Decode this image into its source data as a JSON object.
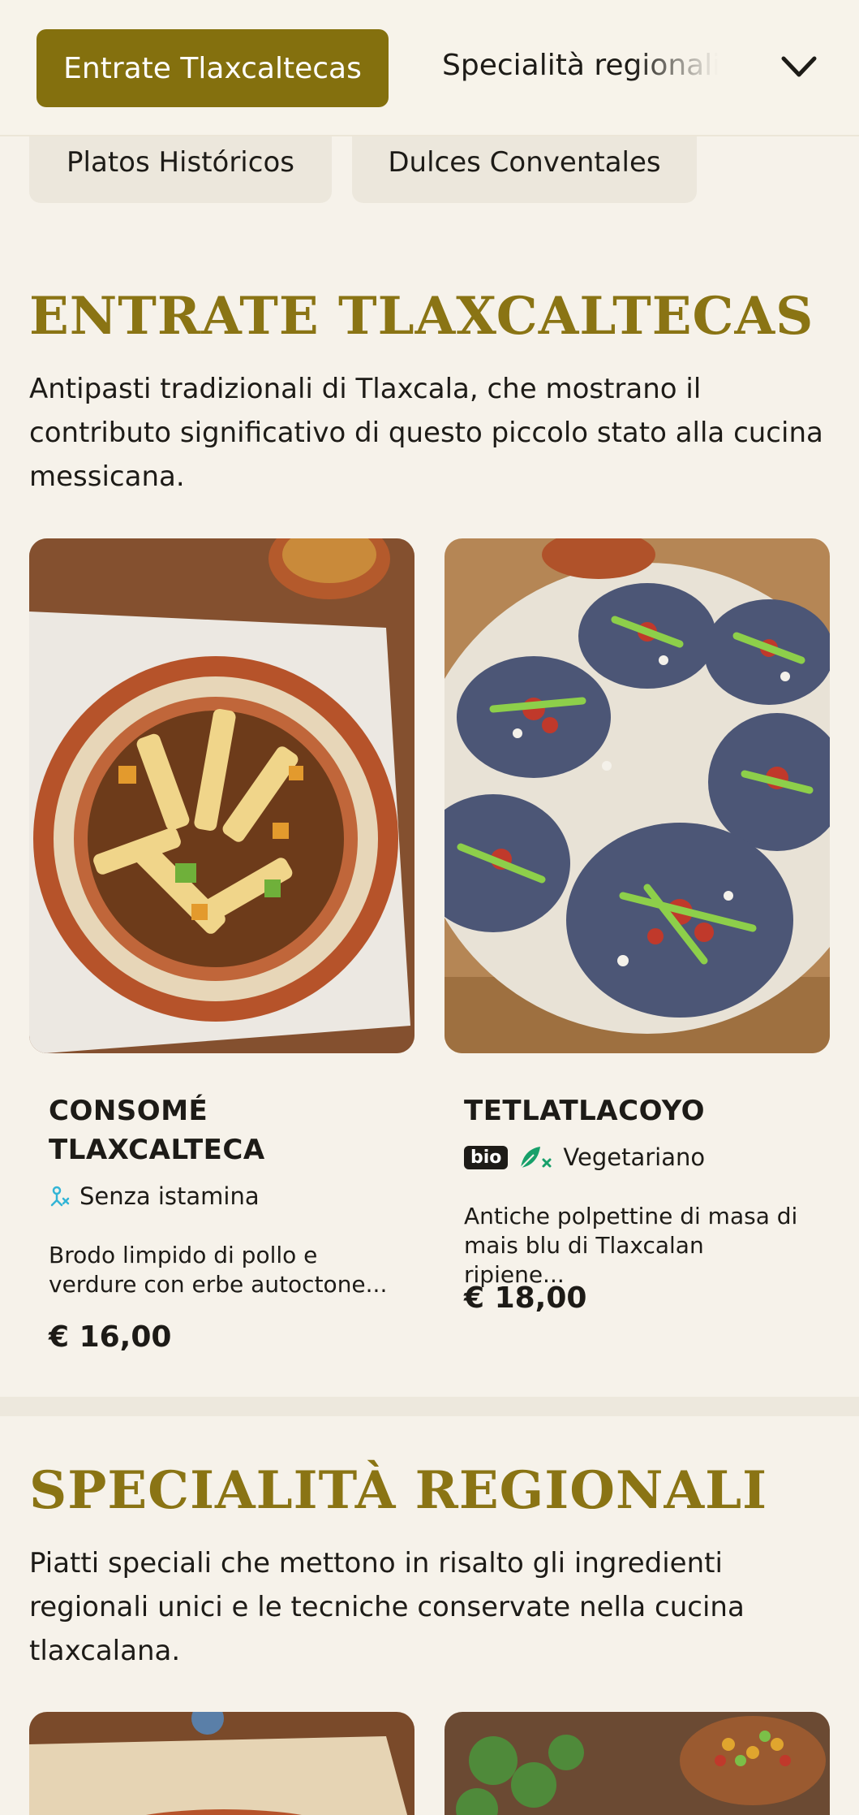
{
  "nav": {
    "active_tab": "Entrate Tlaxcaltecas",
    "next_tab": "Specialità regionali",
    "chips": [
      "Platos Históricos",
      "Dulces Conventales"
    ]
  },
  "sections": [
    {
      "title": "ENTRATE TLAXCALTECAS",
      "description": "Antipasti tradizionali di Tlaxcala, che mostrano il contributo significativo di questo piccolo stato alla cucina messicana.",
      "dishes": [
        {
          "name_line1": "CONSOMÉ",
          "name_line2": "TLAXCALTECA",
          "tag": "Senza istamina",
          "desc_line1": "Brodo limpido di pollo e",
          "desc_line2": "verdure con erbe autoctone...",
          "price": "€ 16,00"
        },
        {
          "name_line1": "TETLATLACOYO",
          "bio_badge": "bio",
          "tag": "Vegetariano",
          "desc_line1": "Antiche polpettine di masa di",
          "desc_line2": "mais blu di Tlaxcalan ripiene...",
          "price": "€ 18,00"
        }
      ]
    },
    {
      "title": "SPECIALITÀ REGIONALI",
      "description": "Piatti speciali che mettono in risalto gli ingredienti regionali unici e le tecniche conservate nella cucina tlaxcalana."
    }
  ],
  "colors": {
    "accent": "#84700e",
    "title": "#8a7414",
    "background": "#f6f2ea"
  },
  "icons": [
    "chevron-down-icon",
    "no-histamine-icon",
    "vegetarian-icon"
  ]
}
